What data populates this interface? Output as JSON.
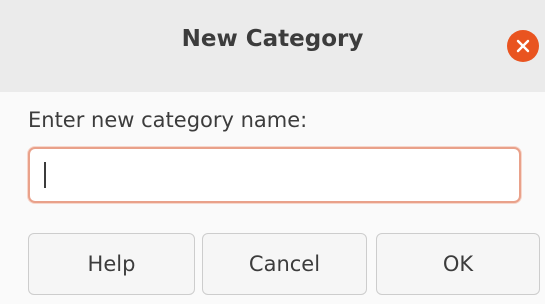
{
  "dialog": {
    "title": "New Category",
    "close_icon": "close-icon",
    "accent_color": "#e95420"
  },
  "form": {
    "prompt_label": "Enter new category name:",
    "input_value": "",
    "input_placeholder": ""
  },
  "buttons": {
    "help_label": "Help",
    "cancel_label": "Cancel",
    "ok_label": "OK"
  }
}
